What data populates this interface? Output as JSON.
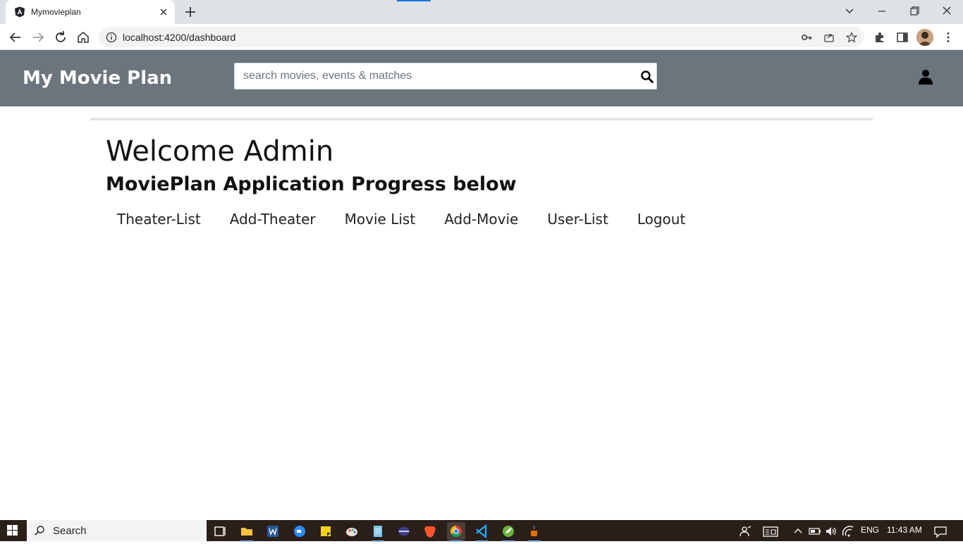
{
  "browser": {
    "tab_title": "Mymovieplan",
    "url": "localhost:4200/dashboard"
  },
  "app": {
    "brand": "My Movie Plan",
    "search_placeholder": "search movies, events & matches"
  },
  "content": {
    "welcome": "Welcome Admin",
    "subtitle": "MoviePlan Application Progress below",
    "nav": [
      "Theater-List",
      "Add-Theater",
      "Movie List",
      "Add-Movie",
      "User-List",
      "Logout"
    ]
  },
  "taskbar": {
    "search_label": "Search",
    "lang": "ENG",
    "time": "11:43 AM"
  },
  "colors": {
    "header_bg": "#6c757d",
    "tabstrip_bg": "#dee1e6"
  }
}
